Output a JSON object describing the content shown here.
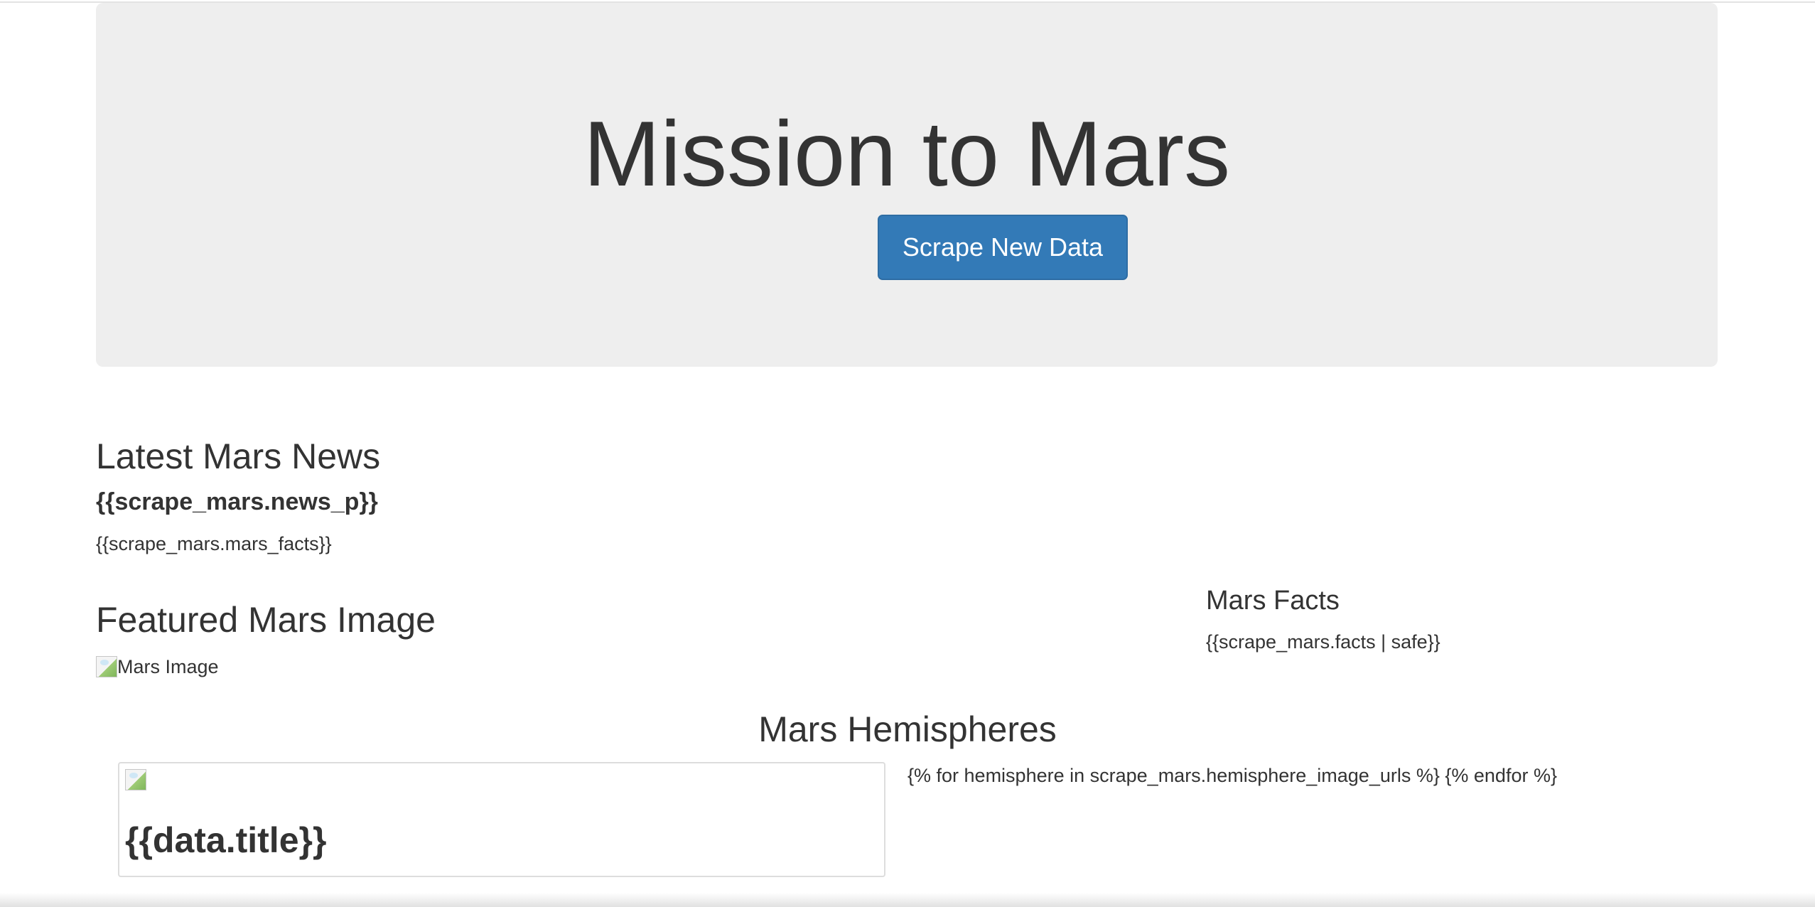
{
  "jumbotron": {
    "title": "Mission to Mars",
    "button_label": "Scrape New Data"
  },
  "news": {
    "heading": "Latest Mars News",
    "title_template": "{{scrape_mars.news_p}}",
    "paragraph_template": "{{scrape_mars.mars_facts}}"
  },
  "featured": {
    "heading": "Featured Mars Image",
    "image_alt": "Mars Image"
  },
  "facts": {
    "heading": "Mars Facts",
    "table_template": "{{scrape_mars.facts | safe}}"
  },
  "hemispheres": {
    "heading": "Mars Hemispheres",
    "card_title_template": "{{data.title}}",
    "loop_template": "{% for hemisphere in scrape_mars.hemisphere_image_urls %} {% endfor %}"
  },
  "colors": {
    "button_bg": "#337ab7",
    "jumbotron_bg": "#eeeeee",
    "text": "#333333"
  }
}
